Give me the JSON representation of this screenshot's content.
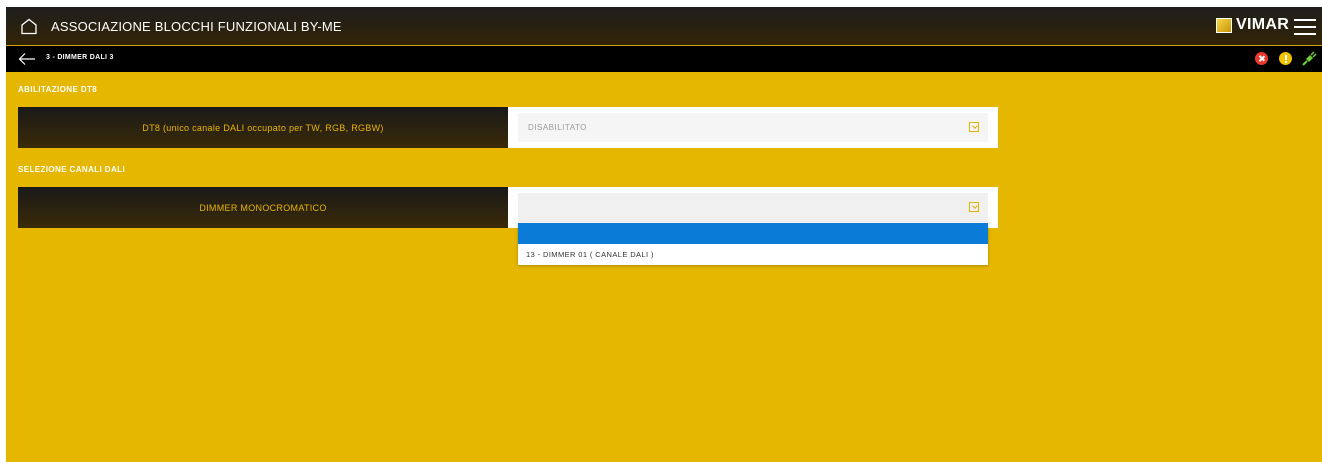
{
  "header": {
    "title": "ASSOCIAZIONE BLOCCHI FUNZIONALI BY-ME",
    "logo_text": "VIMAR",
    "home_icon": "home-icon",
    "menu_icon": "hamburger-menu-icon"
  },
  "subheader": {
    "title": "3 - DIMMER DALI 3",
    "back_icon": "back-arrow-icon",
    "status_icons": [
      "error-icon",
      "warning-icon",
      "connection-plug-icon"
    ]
  },
  "sections": {
    "dt8": {
      "label": "ABILITAZIONE DT8",
      "row_label": "DT8 (unico canale DALI occupato per TW, RGB, RGBW)",
      "select_value": "DISABILITATO"
    },
    "channels": {
      "label": "SELEZIONE CANALI DALI",
      "row_label": "DIMMER MONOCROMATICO",
      "select_value": "",
      "options": [
        "",
        "13 - DIMMER 01 ( CANALE DALI )"
      ]
    }
  },
  "colors": {
    "background": "#e5b700",
    "header_dark": "#1e1e1e",
    "accent": "#e8b400",
    "selected_option": "#0a7bd6",
    "error": "#e8382e",
    "warning": "#f2c200"
  }
}
